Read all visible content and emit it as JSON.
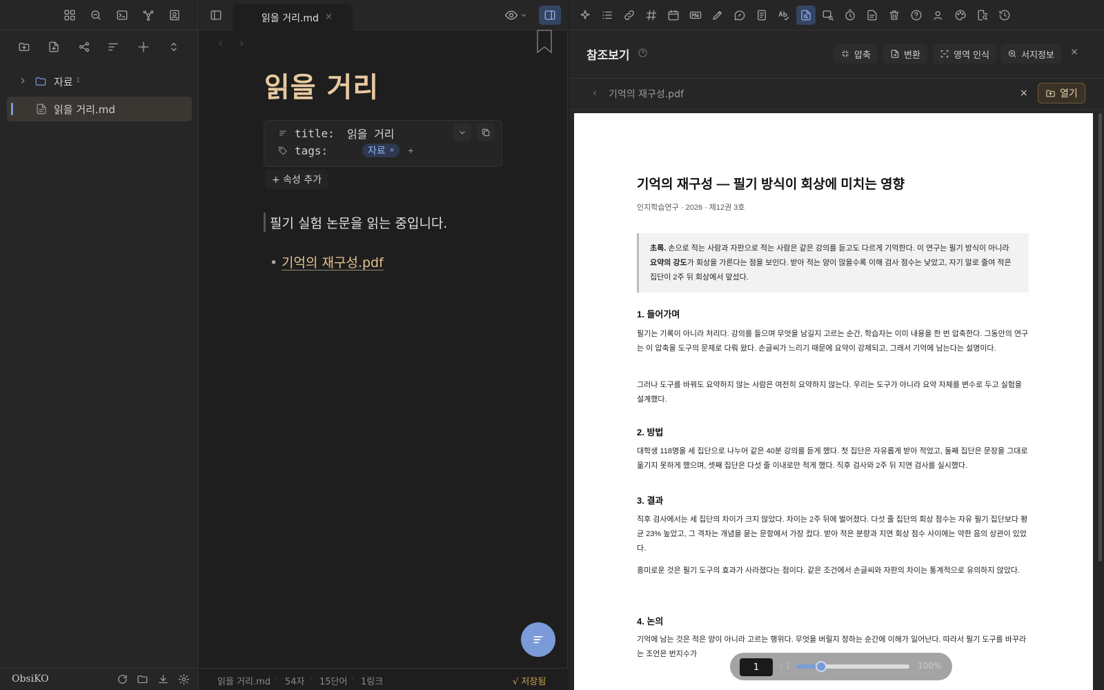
{
  "app": {
    "vault_name": "ObsiKO"
  },
  "file_tree": [
    {
      "label": "자료",
      "type": "folder",
      "badge": "1"
    },
    {
      "label": "읽을 거리.md",
      "type": "file",
      "active": true
    }
  ],
  "tab": {
    "label": "읽을 거리.md",
    "close": "×"
  },
  "note": {
    "title": "읽을 거리",
    "properties": [
      {
        "key": "title:",
        "value": "읽을 거리",
        "icon": "text-lines-icon"
      },
      {
        "key": "tags:",
        "tags": [
          {
            "label": "자료",
            "remove": "×"
          }
        ],
        "add": "+",
        "icon": "tag-icon"
      }
    ],
    "add_property": "+ 속성 추가",
    "body": "필기 실험 논문을 읽는 중입니다.",
    "bullet": "•",
    "link": "기억의 재구성.pdf"
  },
  "status_bar": {
    "file": "읽을 거리.md",
    "chars": "54자",
    "words": "15단어",
    "links": "1링크",
    "saved": "√ 저장됨"
  },
  "reference_panel": {
    "title": "참조보기",
    "actions": [
      {
        "label": "압축",
        "icon": "compress-icon"
      },
      {
        "label": "변환",
        "icon": "convert-icon"
      },
      {
        "label": "영역 인식",
        "icon": "area-scan-icon"
      },
      {
        "label": "서지정보",
        "icon": "bibliography-icon"
      }
    ],
    "file_name": "기억의 재구성.pdf",
    "file_close": "×",
    "open_label": "열기"
  },
  "pdf": {
    "title": "기억의 재구성 — 필기 방식이 회상에 미치는 영향",
    "meta": "인지학습연구 · 2026 · 제12권 3호",
    "abstract_label": "초록.",
    "abstract_a": " 손으로 적는 사람과 자판으로 적는 사람은 같은 강의를 듣고도 다르게 기억한다. 이 연구는 필기 방식이 아니라 ",
    "abstract_bold": "요약의 강도",
    "abstract_b": "가 회상을 가른다는 점을 보인다. 받아 적는 양이 많을수록 이해 검사 점수는 낮았고, 자기 말로 줄여 적은 집단이 2주 뒤 회상에서 앞섰다.",
    "sections": [
      {
        "heading": "1. 들어가며",
        "paras": [
          "필기는 기록이 아니라 처리다. 강의를 들으며 무엇을 남길지 고르는 순간, 학습자는 이미 내용을 한 번 압축한다. 그동안의 연구는 이 압축을 도구의 문제로 다뤄 왔다. 손글씨가 느리기 때문에 요약이 강제되고, 그래서 기억에 남는다는 설명이다.",
          "그러나 도구를 바꿔도 요약하지 않는 사람은 여전히 요약하지 않는다. 우리는 도구가 아니라 요약 자체를 변수로 두고 실험을 설계했다."
        ]
      },
      {
        "heading": "2. 방법",
        "paras": [
          "대학생 118명을 세 집단으로 나누어 같은 40분 강의를 듣게 했다. 첫 집단은 자유롭게 받아 적었고, 둘째 집단은 문장을 그대로 옮기지 못하게 했으며, 셋째 집단은 다섯 줄 이내로만 적게 했다. 직후 검사와 2주 뒤 지연 검사를 실시했다."
        ]
      },
      {
        "heading": "3. 결과",
        "paras": [
          "직후 검사에서는 세 집단의 차이가 크지 않았다. 차이는 2주 뒤에 벌어졌다. 다섯 줄 집단의 회상 점수는 자유 필기 집단보다 평균 23% 높았고, 그 격차는 개념을 묻는 문항에서 가장 컸다. 받아 적은 분량과 지연 회상 점수 사이에는 약한 음의 상관이 있었다.",
          "흥미로운 것은 필기 도구의 효과가 사라졌다는 점이다. 같은 조건에서 손글씨와 자판의 차이는 통계적으로 유의하지 않았다."
        ]
      },
      {
        "heading": "4. 논의",
        "paras": [
          "기억에 남는 것은 적은 양이 아니라 고르는 행위다. 무엇을 버릴지 정하는 순간에 이해가 일어난다. 따라서 필기 도구를 바꾸라는 조언은 번지수가"
        ]
      }
    ],
    "page_current": "1",
    "page_total": "/ 1",
    "zoom_label": "100%",
    "zoom_level": 0.22
  }
}
